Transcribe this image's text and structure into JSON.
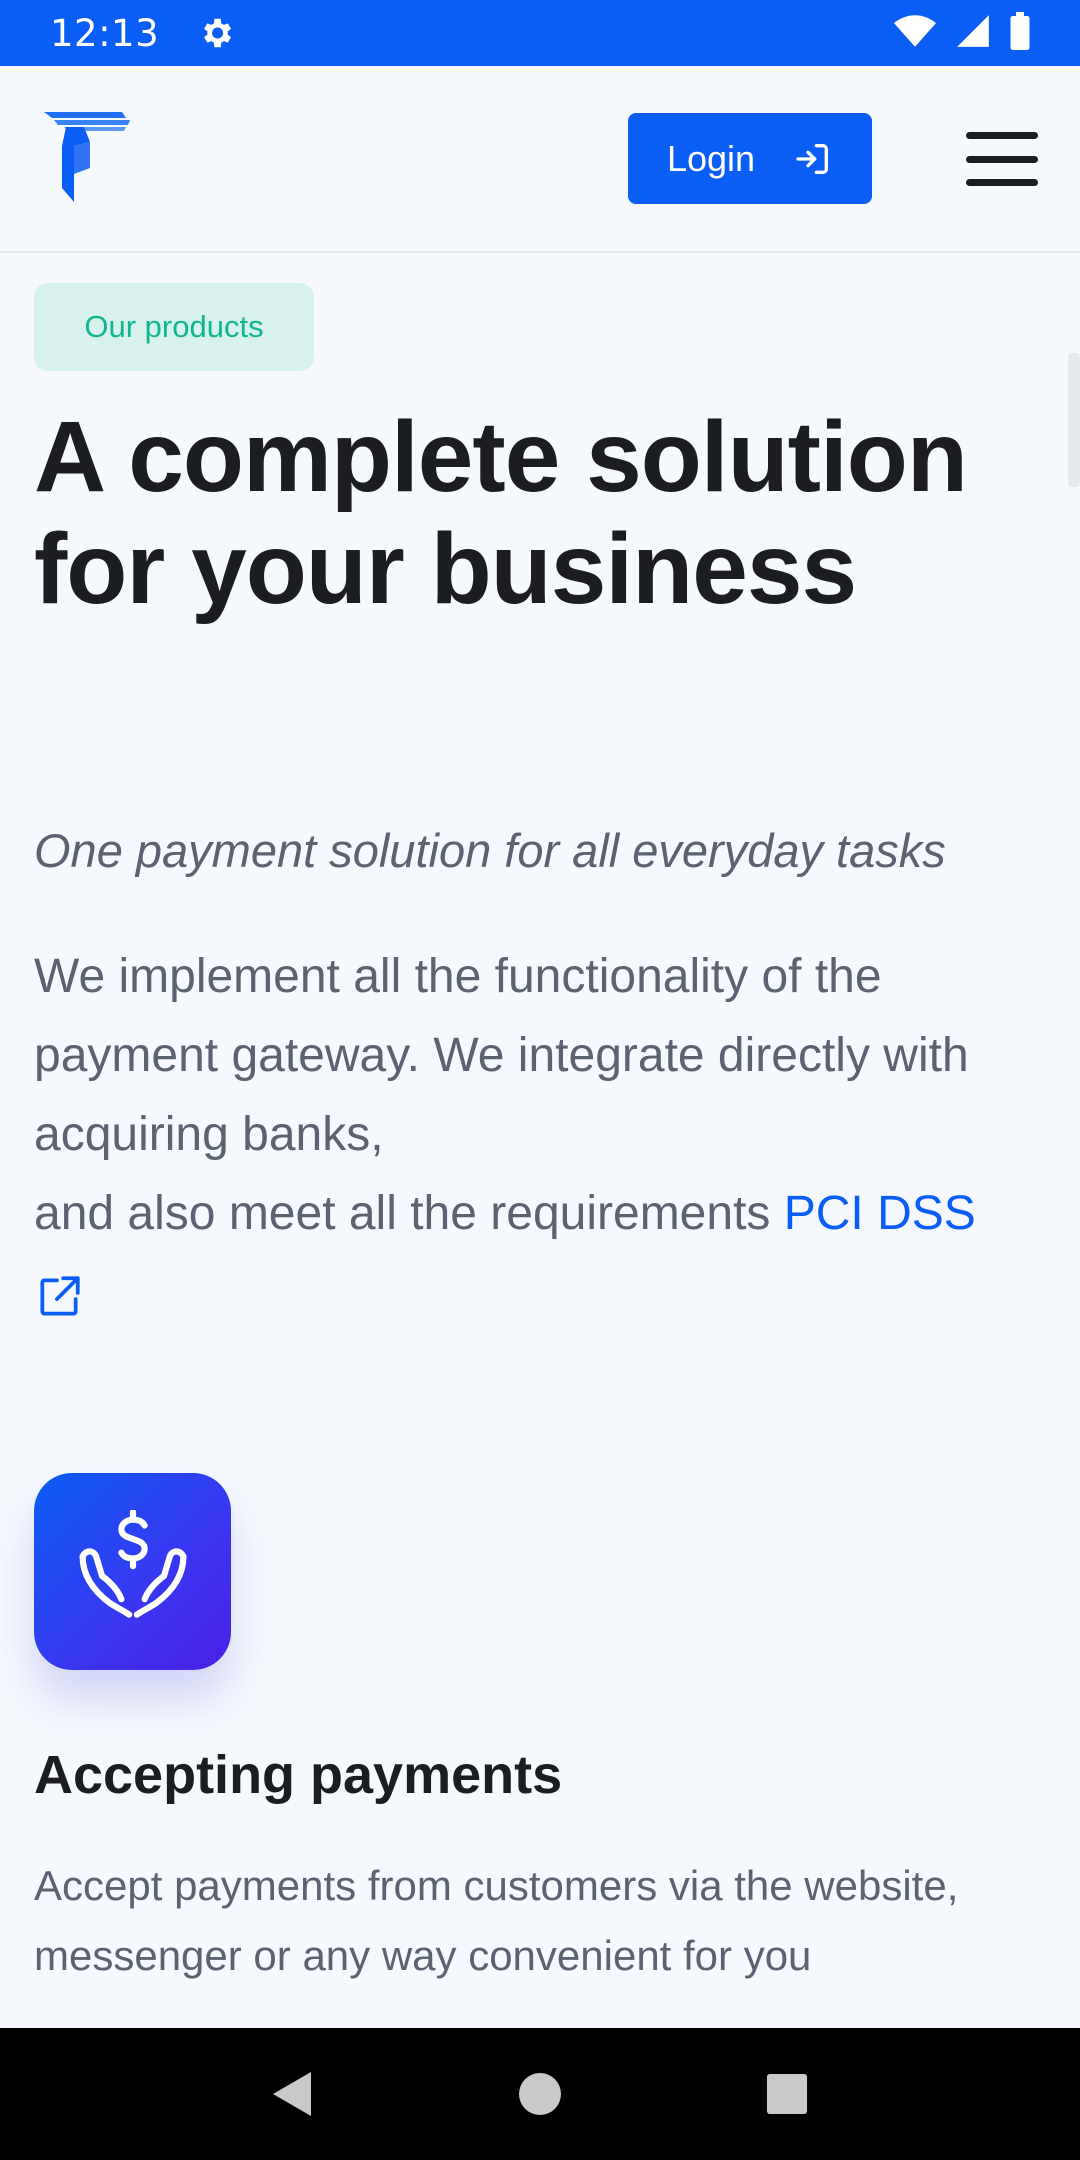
{
  "status_bar": {
    "time": "12:13",
    "icons": [
      "settings-icon",
      "wifi-icon",
      "signal-icon",
      "battery-icon"
    ]
  },
  "header": {
    "logo_name": "brand-logo",
    "login_label": "Login",
    "login_icon": "login-icon",
    "menu_icon": "hamburger-menu-icon"
  },
  "hero": {
    "tag": "Our products",
    "title": "A complete solution for your business",
    "subtitle": "One payment solution for all everyday tasks",
    "description_part1": "We implement all the functionality of the payment gateway. We integrate directly with acquiring banks,",
    "description_part2": "and also meet all the requirements ",
    "link_text": "PCI DSS"
  },
  "feature": {
    "icon": "hands-dollar-icon",
    "title": "Accepting payments",
    "text": "Accept payments from customers via the website, messenger or any way convenient for you"
  },
  "colors": {
    "brand_blue": "#0a5df5",
    "tag_bg": "#d7f2ec",
    "tag_text": "#13b591",
    "body_text": "#5b6371",
    "heading_text": "#1c1d22"
  },
  "nav": {
    "back": "back-icon",
    "home": "home-icon",
    "recents": "recents-icon"
  }
}
